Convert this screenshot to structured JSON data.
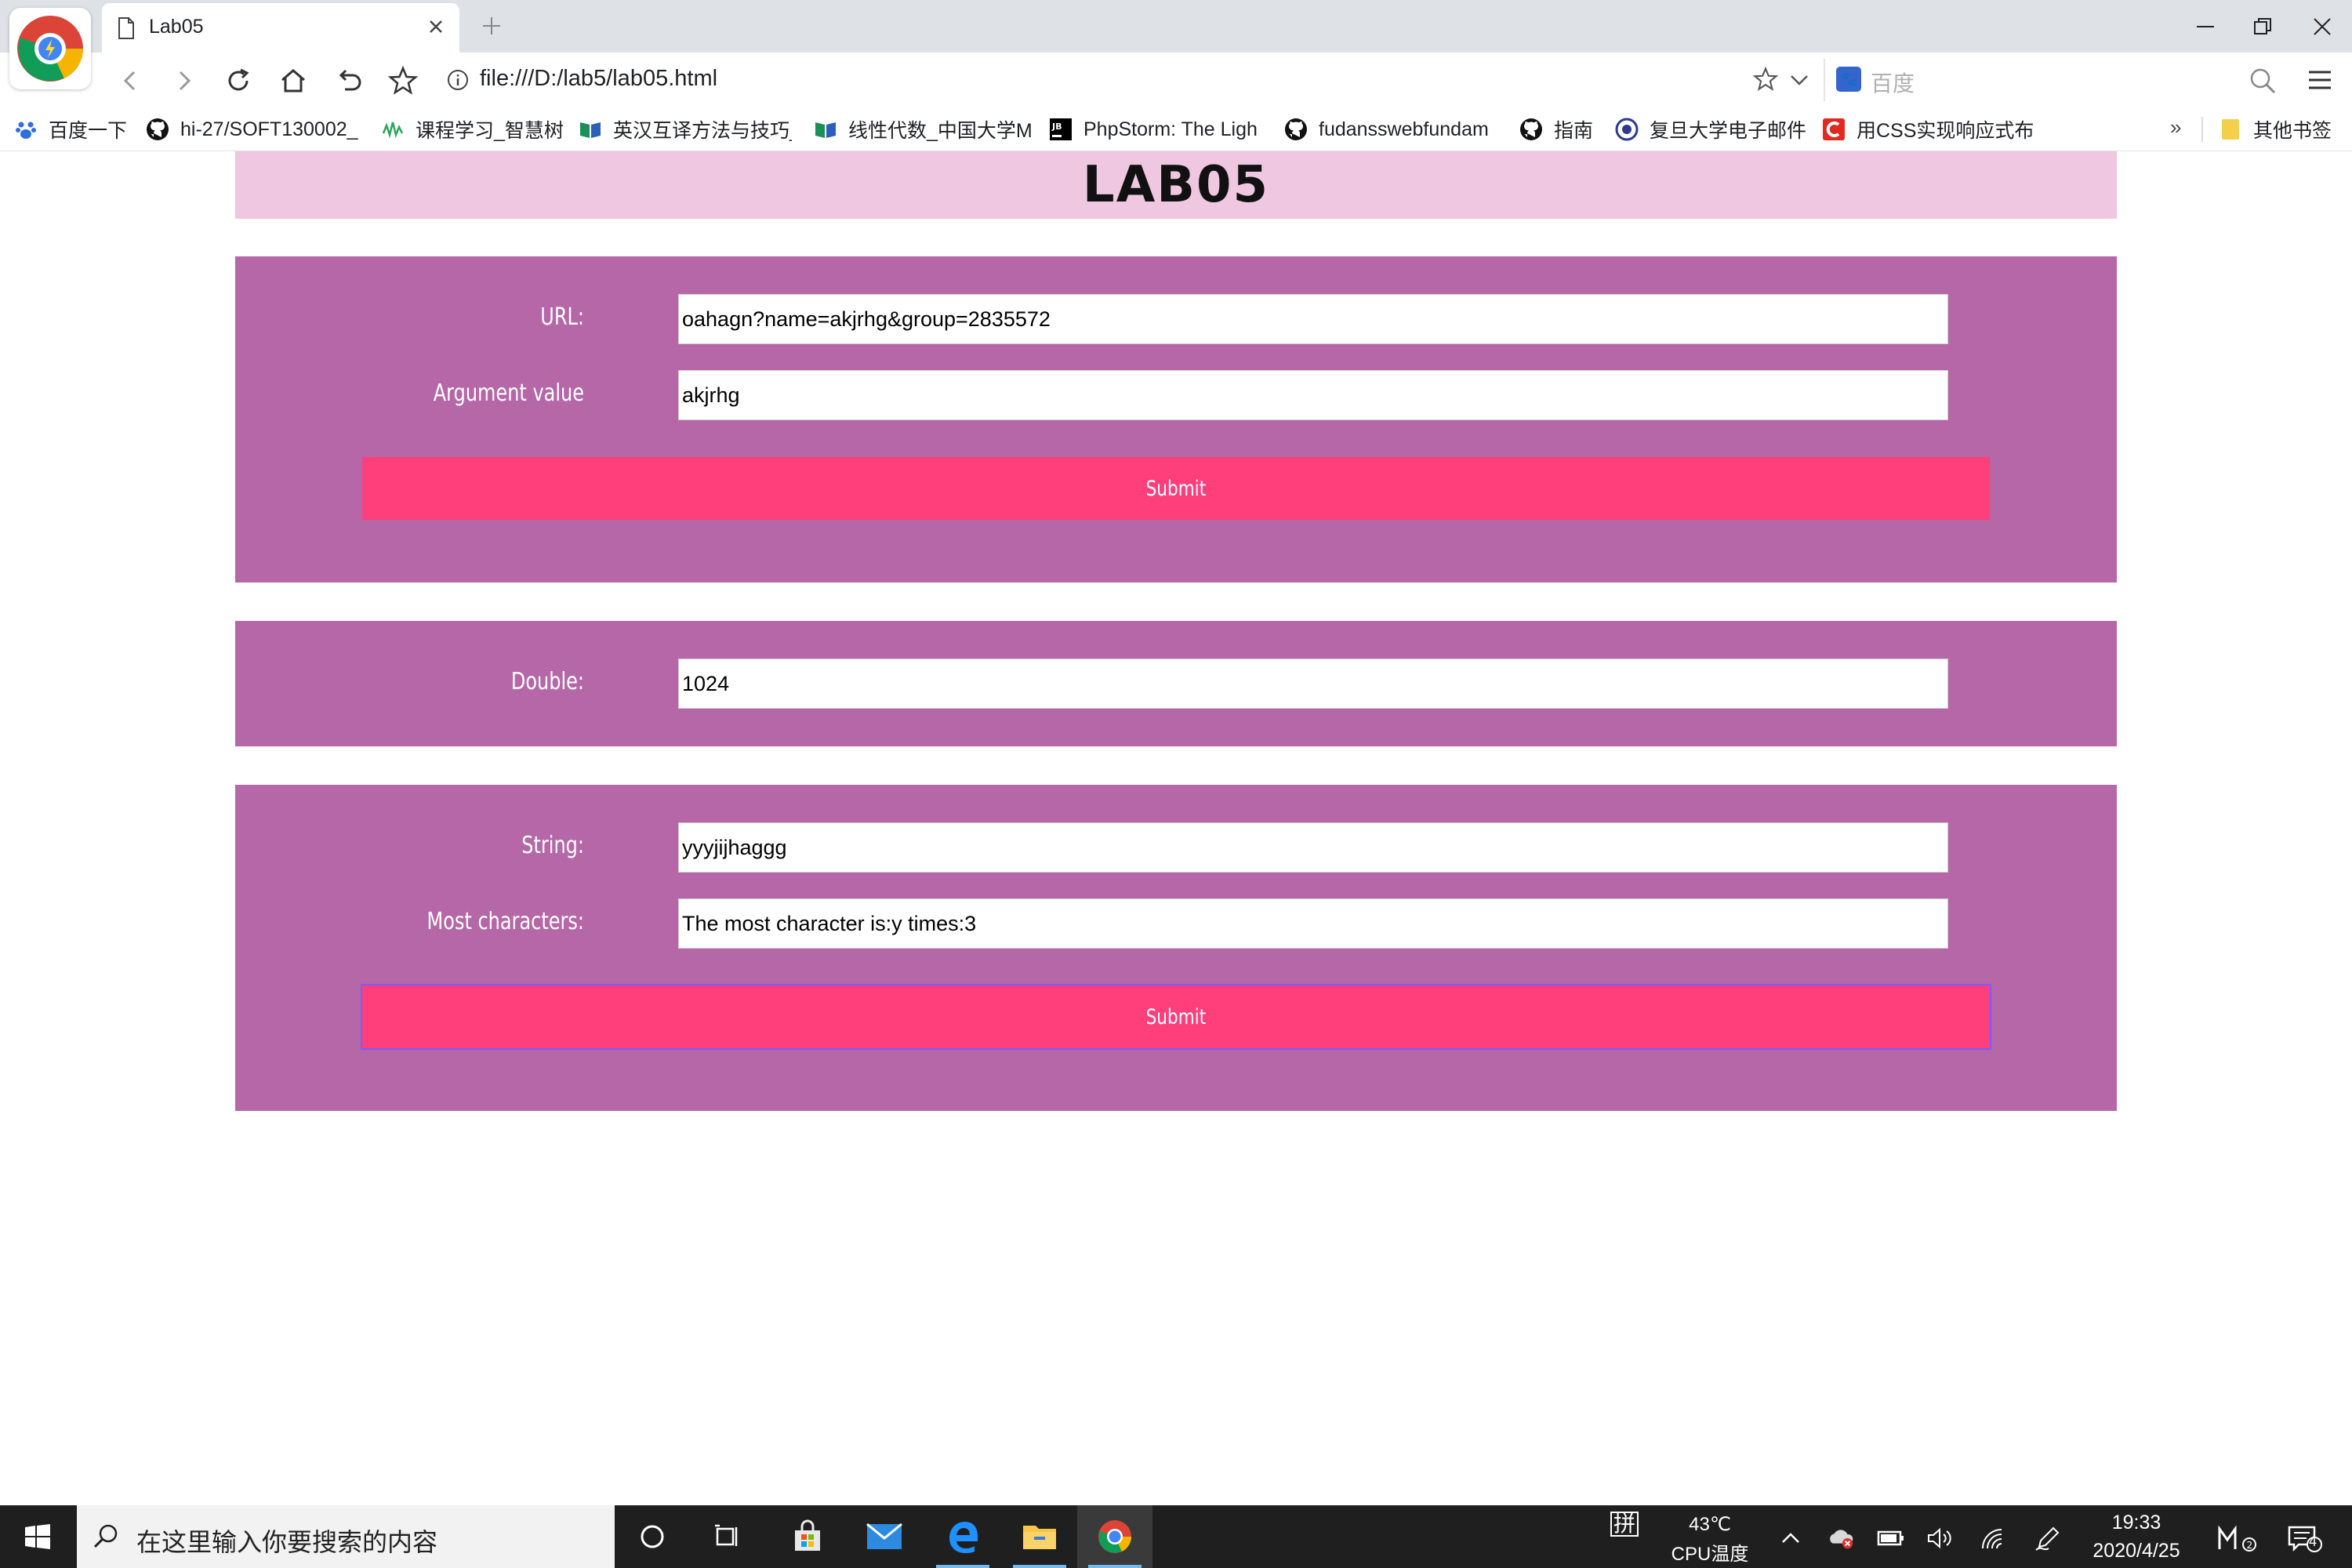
{
  "browser": {
    "tab_title": "Lab05",
    "url": "file:///D:/lab5/lab05.html",
    "search_placeholder": "百度"
  },
  "bookmarks": [
    {
      "label": "百度一下",
      "icon": "baidu-paw-icon"
    },
    {
      "label": "hi-27/SOFT130002_",
      "icon": "github-icon"
    },
    {
      "label": "课程学习_智慧树",
      "icon": "zhihuishu-icon"
    },
    {
      "label": "英汉互译方法与技巧_",
      "icon": "mooc-book-icon"
    },
    {
      "label": "线性代数_中国大学M",
      "icon": "mooc-book-icon"
    },
    {
      "label": "PhpStorm: The Ligh",
      "icon": "jetbrains-icon"
    },
    {
      "label": "fudansswebfundam",
      "icon": "github-icon"
    },
    {
      "label": "指南",
      "icon": "github-icon"
    },
    {
      "label": "复旦大学电子邮件",
      "icon": "fudan-logo-icon"
    },
    {
      "label": "用CSS实现响应式布",
      "icon": "csdn-icon"
    }
  ],
  "bookmarks_more": "»",
  "other_bookmarks": "其他书签",
  "page": {
    "title": "LAB05",
    "panel1": {
      "url_label": "URL:",
      "url_value": "oahagn?name=akjrhg&group=2835572",
      "arg_label": "Argument value",
      "arg_value": "akjrhg",
      "submit_label": "Submit"
    },
    "panel2": {
      "double_label": "Double:",
      "double_value": "1024"
    },
    "panel3": {
      "string_label": "String:",
      "string_value": "yyyjijhaggg",
      "most_label": "Most characters:",
      "most_value": "The most character is:y times:3",
      "submit_label": "Submit"
    }
  },
  "taskbar": {
    "search_placeholder": "在这里输入你要搜索的内容",
    "ime": "拼",
    "temp": "43℃",
    "temp_label": "CPU温度",
    "time": "19:33",
    "date": "2020/4/25",
    "notifications": "4"
  },
  "colors": {
    "header_bg": "#efc7e0",
    "panel_bg": "#b567a8",
    "submit_bg": "#ff3e7c"
  }
}
